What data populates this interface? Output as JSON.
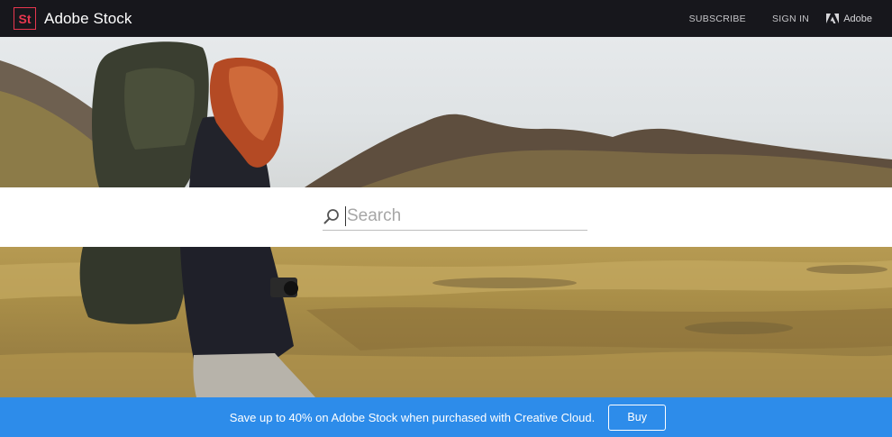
{
  "header": {
    "logo_mark": "St",
    "brand_name": "Adobe Stock",
    "nav": {
      "subscribe_label": "SUBSCRIBE",
      "sign_in_label": "SIGN IN",
      "adobe_label": "Adobe"
    },
    "logo_color": "#e8374f",
    "background_color": "#17171c"
  },
  "hero": {
    "icon": "hiker-backpack-mountain-photo"
  },
  "search": {
    "placeholder": "Search",
    "value": "",
    "icon": "search-icon"
  },
  "promo": {
    "text": "Save up to 40% on Adobe Stock when purchased with Creative Cloud.",
    "buy_label": "Buy",
    "background_color": "#2d8cea"
  }
}
